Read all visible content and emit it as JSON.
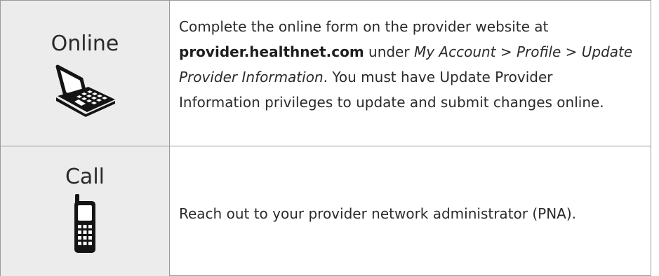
{
  "rows": [
    {
      "method": "Online",
      "icon": "laptop-icon",
      "desc_part1": "Complete the online form on the provider website at ",
      "url": "provider.healthnet.com",
      "desc_part2": " under ",
      "path": "My Account > Profile > Update Provider Information",
      "desc_part3": ". You must have Update Provider Information privileges to update and submit changes online."
    },
    {
      "method": "Call",
      "icon": "mobile-phone-icon",
      "desc": "Reach out to your provider network administrator (PNA)."
    }
  ],
  "colors": {
    "method_column_bg": "#ececec",
    "border": "#9a9a9a",
    "text": "#2b2b2b"
  }
}
